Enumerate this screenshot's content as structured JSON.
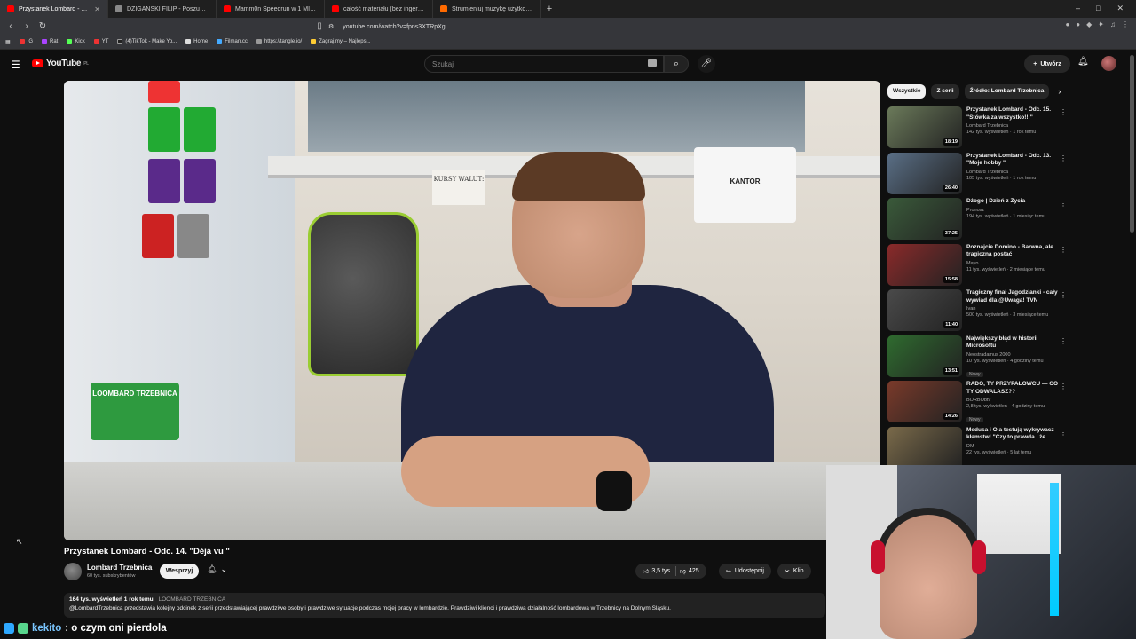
{
  "browser": {
    "tabs": [
      {
        "title": "Przystanek Lombard - Odc. 1",
        "active": true
      },
      {
        "title": "DZIGAŃSKI FILIP - Poszukiwani - Po",
        "active": false
      },
      {
        "title": "Mamm0n Speedrun w 1 MINUTE - Y",
        "active": false
      },
      {
        "title": "całość materiału (bez ingerencji) dot",
        "active": false
      },
      {
        "title": "Strumieniuj muzykę użytkownika",
        "active": false
      }
    ],
    "new_tab": "+",
    "url": "youtube.com/watch?v=fpns3XTRpXg",
    "bookmarks": [
      "IG",
      "Rat",
      "Kick",
      "YT",
      "(4)TikTok - Make Yo...",
      "Home",
      "Filman.cc",
      "https://tangle.io/",
      "Zagraj.my – Najleps..."
    ]
  },
  "header": {
    "logo_text": "YouTube",
    "logo_region": "PL",
    "search_placeholder": "Szukaj",
    "create_label": "Utwórz"
  },
  "video": {
    "title": "Przystanek Lombard - Odc. 14. \"Déjà vu \"",
    "scene_signs": {
      "kursy": "KURSY WALUT:",
      "kantor": "KANTOR",
      "display": "LOOMBARD TRZEBNICA"
    },
    "channel_name": "Lombard Trzebnica",
    "channel_subs": "60 tys. subskrybentów",
    "support_label": "Wesprzyj",
    "likes": "3,5 tys.",
    "dislikes": "425",
    "share_label": "Udostępnij",
    "clip_label": "Klip",
    "views_date": "164 tys. wyświetleń  1 rok temu",
    "tag": "LOOMBARD TRZEBNICA",
    "description": "@LombardTrzebnica przedstawia kolejny odcinek z serii przedstawiającej prawdziwe osoby i prawdziwe sytuacje podczas mojej pracy w lombardzie. Prawdziwi klienci i prawdziwa działalność lombardowa w Trzebnicy na Dolnym Śląsku."
  },
  "chips": [
    "Wszystkie",
    "Z serii",
    "Źródło: Lombard Trzebnica"
  ],
  "recommendations": [
    {
      "title": "Przystanek Lombard - Odc. 15. \"Stówka za wszystko!!!\"",
      "channel": "Lombard Trzebnica",
      "meta": "142 tys. wyświetleń · 1 rok temu",
      "duration": "18:19",
      "new": "",
      "color": "#6b7a5a"
    },
    {
      "title": "Przystanek Lombard - Odc. 13. \"Moje hobby \"",
      "channel": "Lombard Trzebnica",
      "meta": "105 tys. wyświetleń · 1 rok temu",
      "duration": "26:40",
      "new": "",
      "color": "#5a6f86"
    },
    {
      "title": "Dżogo | Dzień z Życia",
      "channel": "Pronosz",
      "meta": "194 tys. wyświetleń · 1 miesiąc temu",
      "duration": "37:25",
      "new": "",
      "color": "#3a5a3a"
    },
    {
      "title": "Poznajcie Domino - Barwna, ale tragiczna postać",
      "channel": "Mayo",
      "meta": "11 tys. wyświetleń · 2 miesiące temu",
      "duration": "15:58",
      "new": "",
      "color": "#8a2a2a"
    },
    {
      "title": "Tragiczny finał Jagodzianki - cały wywiad dla @Uwaga! TVN",
      "channel": "Ivan",
      "meta": "500 tys. wyświetleń · 3 miesiące temu",
      "duration": "11:40",
      "new": "",
      "color": "#4a4a4a"
    },
    {
      "title": "Największy błąd w historii Microsoftu",
      "channel": "Neostradamus 2000",
      "meta": "10 tys. wyświetleń · 4 godziny temu",
      "duration": "13:51",
      "new": "Nowy",
      "color": "#2f6b2f"
    },
    {
      "title": "RADO, TY PRZYPAŁOWCU — CO TY ODWALASZ??",
      "channel": "BORBObtv",
      "meta": "2,8 tys. wyświetleń · 4 godziny temu",
      "duration": "14:26",
      "new": "Nowy",
      "color": "#7a3a2a"
    },
    {
      "title": "Medusa i Ola testują wykrywacz kłamstw! \"Czy to prawda , że ...",
      "channel": "DM",
      "meta": "22 tys. wyświetleń · 5 lat temu",
      "duration": "",
      "new": "",
      "color": "#7a6a4a"
    }
  ],
  "chat": {
    "user": "kekito",
    "message": ": o czym oni pierdola"
  }
}
